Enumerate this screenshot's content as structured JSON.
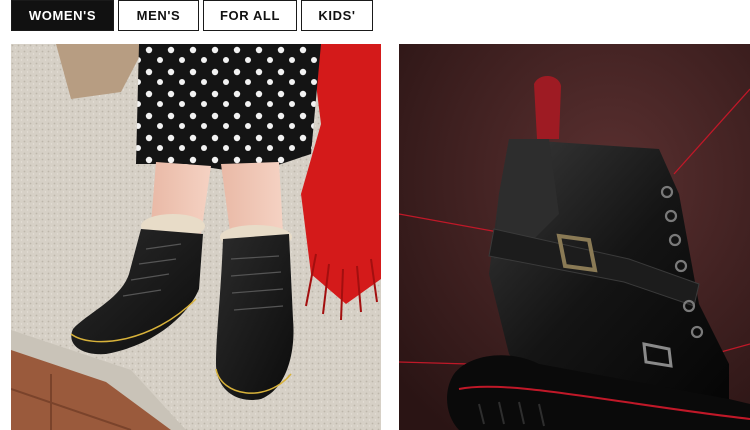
{
  "category_tabs": [
    {
      "label": "WOMEN'S",
      "active": true
    },
    {
      "label": "MEN'S",
      "active": false
    },
    {
      "label": "FOR ALL",
      "active": false
    },
    {
      "label": "KIDS'",
      "active": false
    }
  ],
  "colors": {
    "active_tab_bg": "#111111",
    "active_tab_text": "#ffffff",
    "tab_border": "#1a1a1a",
    "stitching_yellow": "#d8b23a",
    "scarf_red": "#d41a1a",
    "backdrop_maroon": "#3a1f1f"
  },
  "product_cards": [
    {
      "image": "womens-fur-lined-lace-up-boots-photo"
    },
    {
      "image": "buckle-strap-leather-boot-with-red-threads-photo"
    }
  ]
}
